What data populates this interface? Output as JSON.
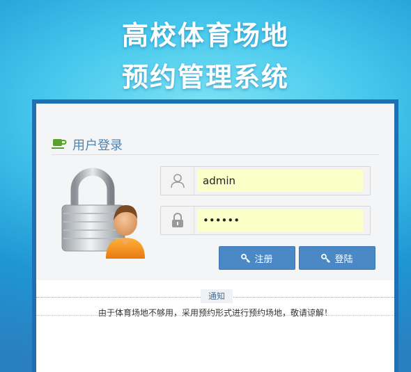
{
  "header": {
    "title_line1": "高校体育场地",
    "title_line2": "预约管理系统"
  },
  "login": {
    "title": "用户登录",
    "username_value": "admin",
    "password_value": "••••••",
    "register_label": "注册",
    "login_label": "登陆"
  },
  "notice": {
    "tab_label": "通知",
    "text": "由于体育场地不够用，采用预约形式进行预约场地，敬请谅解！"
  },
  "colors": {
    "accent": "#4a88c6",
    "frame": "#1f6fb2",
    "input_bg": "#fbffc8"
  },
  "icons": {
    "header": "cup-icon",
    "illustration": "lock-user-icon",
    "username": "user-icon",
    "password": "lock-icon",
    "buttons": "key-icon"
  }
}
